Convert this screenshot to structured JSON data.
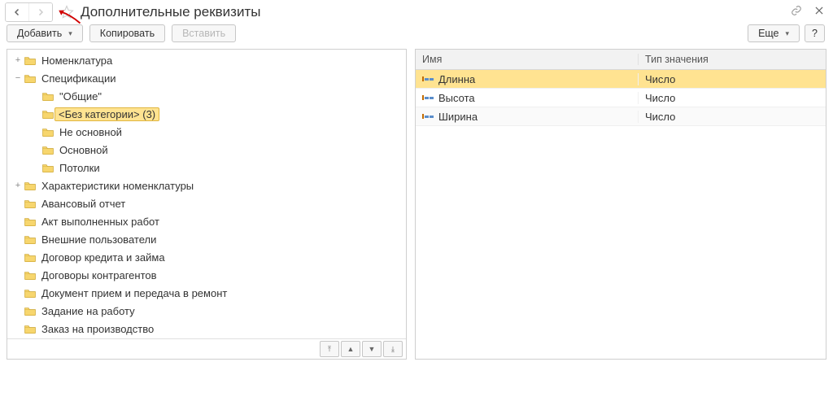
{
  "header": {
    "title": "Дополнительные реквизиты"
  },
  "toolbar": {
    "add": "Добавить",
    "copy": "Копировать",
    "paste": "Вставить",
    "more": "Еще",
    "help": "?"
  },
  "tree": {
    "nodes": [
      {
        "label": "Номенклатура",
        "depth": 0,
        "toggle": "+"
      },
      {
        "label": "Спецификации",
        "depth": 0,
        "toggle": "−"
      },
      {
        "label": "\"Общие\"",
        "depth": 1,
        "toggle": ""
      },
      {
        "label": "<Без категории> (3)",
        "depth": 1,
        "toggle": "",
        "selected": true
      },
      {
        "label": "Не основной",
        "depth": 1,
        "toggle": ""
      },
      {
        "label": "Основной",
        "depth": 1,
        "toggle": ""
      },
      {
        "label": "Потолки",
        "depth": 1,
        "toggle": ""
      },
      {
        "label": "Характеристики номенклатуры",
        "depth": 0,
        "toggle": "+"
      },
      {
        "label": "Авансовый отчет",
        "depth": 0,
        "toggle": ""
      },
      {
        "label": "Акт выполненных работ",
        "depth": 0,
        "toggle": ""
      },
      {
        "label": "Внешние пользователи",
        "depth": 0,
        "toggle": ""
      },
      {
        "label": "Договор кредита и займа",
        "depth": 0,
        "toggle": ""
      },
      {
        "label": "Договоры контрагентов",
        "depth": 0,
        "toggle": ""
      },
      {
        "label": "Документ прием и передача в ремонт",
        "depth": 0,
        "toggle": ""
      },
      {
        "label": "Задание на работу",
        "depth": 0,
        "toggle": ""
      },
      {
        "label": "Заказ на производство",
        "depth": 0,
        "toggle": ""
      }
    ]
  },
  "table": {
    "col_name": "Имя",
    "col_type": "Тип значения",
    "rows": [
      {
        "name": "Длинна",
        "type": "Число",
        "selected": true
      },
      {
        "name": "Высота",
        "type": "Число"
      },
      {
        "name": "Ширина",
        "type": "Число"
      }
    ]
  }
}
